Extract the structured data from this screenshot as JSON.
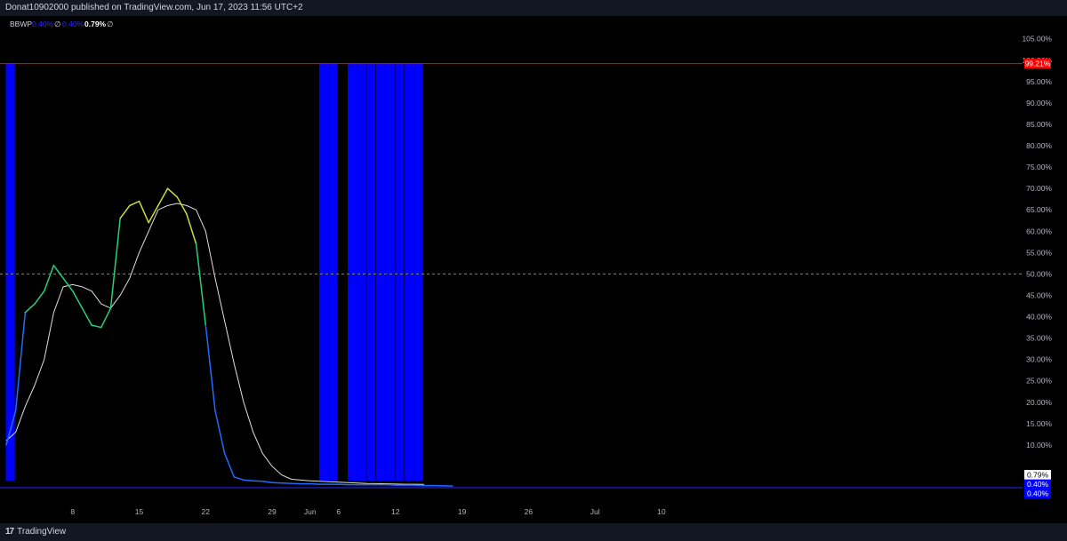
{
  "header": {
    "published": "Donat10902000 published on TradingView.com, Jun 17, 2023 11:56 UTC+2"
  },
  "footer": {
    "brand": "TradingView",
    "logo": "17"
  },
  "legend": {
    "indicator": "BBWP",
    "value1": "0.40%",
    "symbol1": "∅",
    "value2": "0.40%",
    "value3": "0.79%",
    "symbol2": "∅"
  },
  "colors": {
    "background": "#000000",
    "extreme_bar": "#0000ff",
    "ma_line": "#e0e0e0",
    "high_line": "#ff0000",
    "low_line": "#2a2aff",
    "mid_line": "#888888",
    "bbwp_high": "#cddc39",
    "bbwp_mid": "#26d07c",
    "bbwp_low": "#1e6bff"
  },
  "chart_data": {
    "type": "line",
    "ylim": [
      0,
      105
    ],
    "y_ticks": [
      "10.00%",
      "15.00%",
      "20.00%",
      "25.00%",
      "30.00%",
      "35.00%",
      "40.00%",
      "45.00%",
      "50.00%",
      "55.00%",
      "60.00%",
      "65.00%",
      "70.00%",
      "75.00%",
      "80.00%",
      "85.00%",
      "90.00%",
      "95.00%",
      "100.00%",
      "105.00%"
    ],
    "x_tick_labels": [
      "8",
      "15",
      "22",
      "29",
      "Jun",
      "6",
      "12",
      "19",
      "26",
      "Jul",
      "10"
    ],
    "x_tick_bar_index": [
      7,
      14,
      21,
      28,
      32,
      35,
      41,
      48,
      55,
      62,
      69
    ],
    "reference_lines": {
      "high": 99.21,
      "mid": 50,
      "low": 0
    },
    "series": [
      {
        "key": "bbwp",
        "values": [
          10,
          18,
          41,
          43,
          46,
          52,
          49,
          46,
          42,
          38,
          37.5,
          42,
          63,
          66,
          67,
          62,
          66,
          70,
          68,
          64,
          57,
          38,
          18,
          8,
          2.5,
          1.8,
          1.6,
          1.5,
          1.2,
          1.1,
          1.0,
          0.9,
          0.9,
          0.8,
          0.8,
          0.8,
          0.7,
          0.7,
          0.7,
          0.7,
          0.7,
          0.6,
          0.6,
          0.6,
          0.5,
          0.5,
          0.45,
          0.4
        ]
      },
      {
        "key": "ma",
        "values": [
          11,
          13,
          19,
          24,
          30,
          41,
          47,
          47.5,
          47,
          46,
          43,
          42,
          45,
          49,
          55,
          60,
          65,
          66,
          66.5,
          66,
          65,
          60,
          49,
          39,
          29,
          20,
          13,
          8,
          5,
          3,
          2,
          1.8,
          1.6,
          1.5,
          1.4,
          1.3,
          1.2,
          1.1,
          1.0,
          0.95,
          0.9,
          0.85,
          0.8,
          0.8,
          0.79
        ]
      }
    ],
    "extreme_bars": {
      "height": 99.21,
      "bar_index": [
        0,
        33,
        34,
        36,
        37,
        38,
        39,
        40,
        41,
        42,
        43
      ]
    },
    "price_labels": [
      {
        "value": "99.21%",
        "at": 99.21
      },
      {
        "value": "0.79%",
        "at": 3.0
      },
      {
        "value": "0.40%",
        "at": 0.8
      },
      {
        "value": "0.40%",
        "at": -1.4
      }
    ]
  }
}
